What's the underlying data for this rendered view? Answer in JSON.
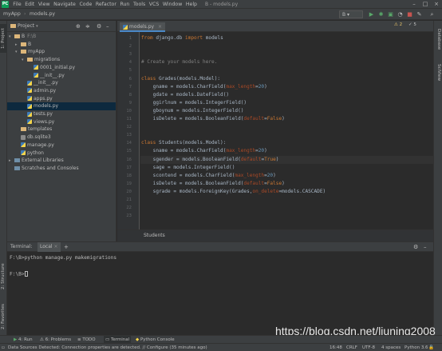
{
  "window": {
    "title": "B - models.py",
    "menu": [
      "File",
      "Edit",
      "View",
      "Navigate",
      "Code",
      "Refactor",
      "Run",
      "Tools",
      "VCS",
      "Window",
      "Help"
    ]
  },
  "navbar": {
    "breadcrumbs": [
      "myApp",
      "models.py"
    ],
    "run_config": "B"
  },
  "project_panel": {
    "title": "Project",
    "tree": [
      {
        "label": "B",
        "indent": 0,
        "icon": "folder",
        "arrow": "▾",
        "path": "F:\\B"
      },
      {
        "label": "B",
        "indent": 1,
        "icon": "folder",
        "arrow": "▸"
      },
      {
        "label": "myApp",
        "indent": 1,
        "icon": "folder",
        "arrow": "▾"
      },
      {
        "label": "migrations",
        "indent": 2,
        "icon": "folder",
        "arrow": "▾"
      },
      {
        "label": "0001_initial.py",
        "indent": 3,
        "icon": "py",
        "arrow": ""
      },
      {
        "label": "__init__.py",
        "indent": 3,
        "icon": "py",
        "arrow": ""
      },
      {
        "label": "__init__.py",
        "indent": 2,
        "icon": "py",
        "arrow": ""
      },
      {
        "label": "admin.py",
        "indent": 2,
        "icon": "py",
        "arrow": ""
      },
      {
        "label": "apps.py",
        "indent": 2,
        "icon": "py",
        "arrow": ""
      },
      {
        "label": "models.py",
        "indent": 2,
        "icon": "py",
        "arrow": ""
      },
      {
        "label": "tests.py",
        "indent": 2,
        "icon": "py",
        "arrow": ""
      },
      {
        "label": "views.py",
        "indent": 2,
        "icon": "py",
        "arrow": ""
      },
      {
        "label": "templates",
        "indent": 1,
        "icon": "folder",
        "arrow": ""
      },
      {
        "label": "db.sqlite3",
        "indent": 1,
        "icon": "db",
        "arrow": ""
      },
      {
        "label": "manage.py",
        "indent": 1,
        "icon": "py",
        "arrow": ""
      },
      {
        "label": "python",
        "indent": 1,
        "icon": "py",
        "arrow": ""
      },
      {
        "label": "External Libraries",
        "indent": 0,
        "icon": "lib",
        "arrow": "▸"
      },
      {
        "label": "Scratches and Consoles",
        "indent": 0,
        "icon": "lib",
        "arrow": ""
      }
    ]
  },
  "editor": {
    "tab_label": "models.py",
    "breadcrumb": "Students",
    "lines": [
      {
        "n": 1,
        "html": "<span class='kw'>from</span> django.db <span class='kw'>import</span> models"
      },
      {
        "n": 2,
        "html": ""
      },
      {
        "n": 3,
        "html": ""
      },
      {
        "n": 4,
        "html": "<span class='cm'># Create your models here.</span>"
      },
      {
        "n": 5,
        "html": ""
      },
      {
        "n": 6,
        "html": "<span class='kw'>class</span> Grades(models.Model):"
      },
      {
        "n": 7,
        "html": "    gname = models.CharField(<span class='pm'>max_length</span>=<span class='num'>20</span>)"
      },
      {
        "n": 8,
        "html": "    gdate = models.DateField()"
      },
      {
        "n": 9,
        "html": "    ggirlnum = models.IntegerField()"
      },
      {
        "n": 10,
        "html": "    gboynum = models.IntegerField()"
      },
      {
        "n": 11,
        "html": "    isDelete = models.BooleanField(<span class='pm'>default</span>=<span class='kw'>False</span>)"
      },
      {
        "n": 12,
        "html": ""
      },
      {
        "n": 13,
        "html": ""
      },
      {
        "n": 14,
        "html": "<span class='kw'>class</span> Students(models.Model):"
      },
      {
        "n": 15,
        "html": "    sname = models.CharField(<span class='pm'>max_length</span>=<span class='num'>20</span>)"
      },
      {
        "n": 16,
        "html": "    sgender = models.BooleanField(<span class='pm'>default</span>=<span class='kw'>True</span>)"
      },
      {
        "n": 17,
        "html": "    sage = models.IntegerField()"
      },
      {
        "n": 18,
        "html": "    scontend = models.CharField(<span class='pm'>max_length</span>=<span class='num'>20</span>)"
      },
      {
        "n": 19,
        "html": "    isDelete = models.BooleanField(<span class='pm'>default</span>=<span class='kw'>False</span>)"
      },
      {
        "n": 20,
        "html": "    sgrade = models.ForeignKey(Grades,<span class='pm'>on_delete</span>=models.CASCADE)"
      },
      {
        "n": 21,
        "html": ""
      },
      {
        "n": 22,
        "html": ""
      },
      {
        "n": 23,
        "html": ""
      }
    ]
  },
  "terminal": {
    "header_label": "Terminal:",
    "tab_label": "Local",
    "add_label": "+",
    "lines": [
      "F:\\B>python manage.py makemigrations",
      "",
      "F:\\B>"
    ]
  },
  "left_strip": {
    "tabs": [
      "1: Project",
      "2: Structure",
      "2: Favorites"
    ]
  },
  "right_strip": {
    "tabs": [
      "Database",
      "SciView"
    ]
  },
  "bottom_tabs": [
    "4: Run",
    "6: Problems",
    "TODO",
    "Terminal",
    "Python Console"
  ],
  "status": {
    "message": "Data Sources Detected: Connection properties are detected. // Configure (35 minutes ago)",
    "position": "16:48",
    "line_sep": "CRLF",
    "encoding": "UTF-8",
    "indent": "4 spaces",
    "interpreter": "Python 3.6"
  },
  "watermark": "https://blog.csdn.net/liuning2008"
}
